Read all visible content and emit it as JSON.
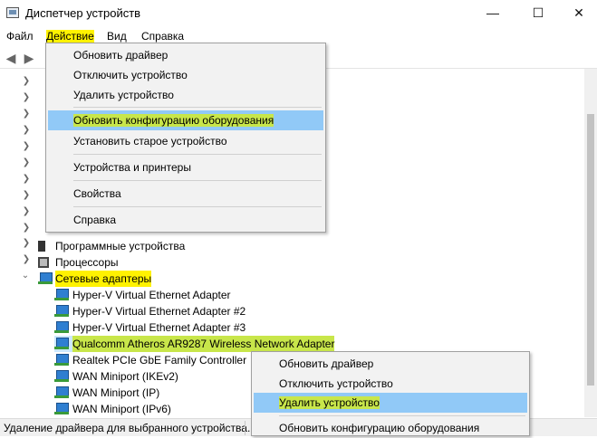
{
  "window": {
    "title": "Диспетчер устройств"
  },
  "menubar": {
    "file": "Файл",
    "action": "Действие",
    "view": "Вид",
    "help": "Справка"
  },
  "action_menu": {
    "items": [
      "Обновить драйвер",
      "Отключить устройство",
      "Удалить устройство",
      "Обновить конфигурацию оборудования",
      "Установить старое устройство",
      "Устройства и принтеры",
      "Свойства",
      "Справка"
    ]
  },
  "tree": {
    "software_devices": "Программные устройства",
    "processors": "Процессоры",
    "network_adapters": "Сетевые адаптеры",
    "adapters": [
      "Hyper-V Virtual Ethernet Adapter",
      "Hyper-V Virtual Ethernet Adapter #2",
      "Hyper-V Virtual Ethernet Adapter #3",
      "Qualcomm Atheros AR9287 Wireless Network Adapter",
      "Realtek PCIe GbE Family Controller",
      "WAN Miniport (IKEv2)",
      "WAN Miniport (IP)",
      "WAN Miniport (IPv6)"
    ]
  },
  "context_menu": {
    "items": [
      "Обновить драйвер",
      "Отключить устройство",
      "Удалить устройство",
      "Обновить конфигурацию оборудования"
    ]
  },
  "status": {
    "text": "Удаление драйвера для выбранного устройства."
  },
  "icons": [
    "app-icon",
    "minimize-icon",
    "maximize-icon",
    "close-icon",
    "back-arrow-icon",
    "forward-arrow-icon",
    "network-adapter-icon",
    "chevron-right-icon",
    "chevron-down-icon"
  ],
  "colors": {
    "selection": "#91c9f7",
    "highlight_yellow": "#fff200",
    "highlight_green": "#c8e64a"
  }
}
